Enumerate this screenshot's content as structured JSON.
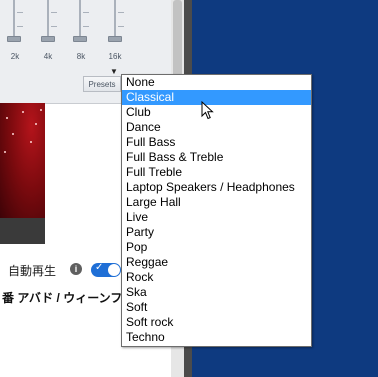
{
  "equalizer": {
    "frequencies": [
      "2k",
      "4k",
      "8k",
      "16k"
    ],
    "presets_label": "Presets"
  },
  "dropdown": {
    "selected": "Classical",
    "items": [
      "None",
      "Classical",
      "Club",
      "Dance",
      "Full Bass",
      "Full Bass & Treble",
      "Full Treble",
      "Laptop Speakers / Headphones",
      "Large Hall",
      "Live",
      "Party",
      "Pop",
      "Reggae",
      "Rock",
      "Ska",
      "Soft",
      "Soft rock",
      "Techno"
    ]
  },
  "autoplay": {
    "label": "自動再生",
    "info": "i",
    "enabled": true
  },
  "video": {
    "title": "番 アバド / ウィーンフ"
  },
  "colors": {
    "selection": "#3399ff",
    "page_background": "#0e3a80",
    "toggle_on": "#1f6fd6"
  }
}
